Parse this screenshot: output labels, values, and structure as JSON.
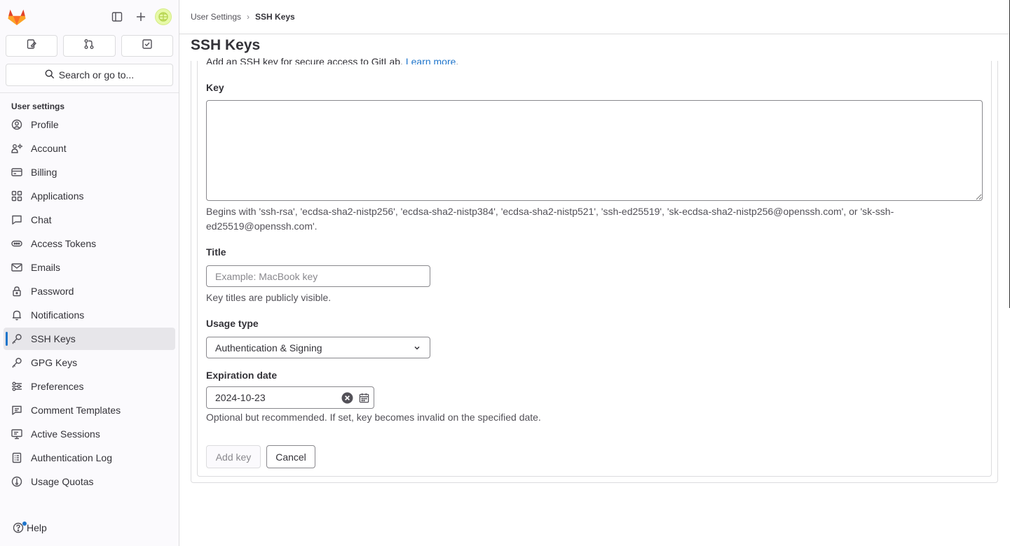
{
  "header": {
    "breadcrumb": [
      "User Settings",
      "SSH Keys"
    ],
    "page_title": "SSH Keys"
  },
  "sidebar": {
    "search_label": "Search or go to...",
    "section_heading": "User settings",
    "items": [
      {
        "label": "Profile",
        "icon": "profile-icon"
      },
      {
        "label": "Account",
        "icon": "account-icon"
      },
      {
        "label": "Billing",
        "icon": "billing-icon"
      },
      {
        "label": "Applications",
        "icon": "applications-icon"
      },
      {
        "label": "Chat",
        "icon": "chat-icon"
      },
      {
        "label": "Access Tokens",
        "icon": "token-icon"
      },
      {
        "label": "Emails",
        "icon": "mail-icon"
      },
      {
        "label": "Password",
        "icon": "lock-icon"
      },
      {
        "label": "Notifications",
        "icon": "bell-icon"
      },
      {
        "label": "SSH Keys",
        "icon": "key-icon",
        "active": true
      },
      {
        "label": "GPG Keys",
        "icon": "key-icon"
      },
      {
        "label": "Preferences",
        "icon": "preferences-icon"
      },
      {
        "label": "Comment Templates",
        "icon": "comment-icon"
      },
      {
        "label": "Active Sessions",
        "icon": "monitor-icon"
      },
      {
        "label": "Authentication Log",
        "icon": "log-icon"
      },
      {
        "label": "Usage Quotas",
        "icon": "quota-icon"
      }
    ],
    "help_label": "Help"
  },
  "form": {
    "intro_text": "Add an SSH key for secure access to GitLab.",
    "intro_link": "Learn more",
    "key_label": "Key",
    "key_value": "",
    "key_help": "Begins with 'ssh-rsa', 'ecdsa-sha2-nistp256', 'ecdsa-sha2-nistp384', 'ecdsa-sha2-nistp521', 'ssh-ed25519', 'sk-ecdsa-sha2-nistp256@openssh.com', or 'sk-ssh-ed25519@openssh.com'.",
    "title_label": "Title",
    "title_placeholder": "Example: MacBook key",
    "title_help": "Key titles are publicly visible.",
    "usage_label": "Usage type",
    "usage_value": "Authentication & Signing",
    "expiration_label": "Expiration date",
    "expiration_value": "2024-10-23",
    "expiration_help": "Optional but recommended. If set, key becomes invalid on the specified date.",
    "add_button": "Add key",
    "cancel_button": "Cancel"
  },
  "colors": {
    "accent": "#1f75cb",
    "logo_orange": "#fc6d26",
    "logo_red": "#e24329",
    "logo_light": "#fca326"
  }
}
